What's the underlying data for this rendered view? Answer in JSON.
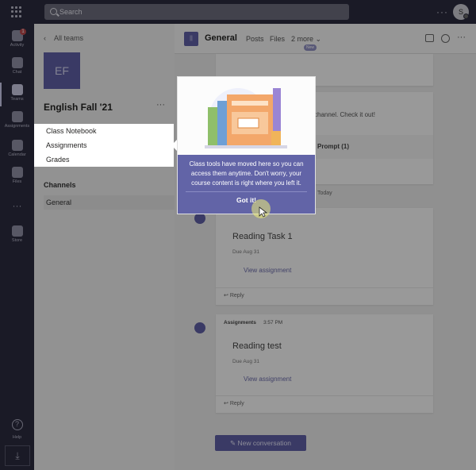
{
  "topbar": {
    "search_placeholder": "Search",
    "more_dots": "···",
    "avatar_initial": "S"
  },
  "rail": {
    "items": [
      {
        "label": "Activity",
        "icon": "bell-icon",
        "badge": "1"
      },
      {
        "label": "Chat",
        "icon": "chat-icon"
      },
      {
        "label": "Teams",
        "icon": "teams-icon"
      },
      {
        "label": "Assignments",
        "icon": "assignments-icon"
      },
      {
        "label": "Calendar",
        "icon": "calendar-icon"
      },
      {
        "label": "Files",
        "icon": "files-icon"
      },
      {
        "label": "Store",
        "icon": "store-icon"
      }
    ],
    "ellipsis": "···",
    "help_label": "Help",
    "help_glyph": "?",
    "download_glyph": "⤓"
  },
  "team": {
    "back_label": "All teams",
    "logo_initials": "EF",
    "name": "English Fall '21",
    "more": "···",
    "tools": [
      "Class Notebook",
      "Assignments",
      "Grades"
    ],
    "channels_heading": "Channels",
    "channels": [
      "General"
    ]
  },
  "channel": {
    "icon_text": "||",
    "name": "General",
    "tabs": [
      "Posts",
      "Files",
      "2 more ⌄"
    ],
    "new_pill": "New",
    "more": "···"
  },
  "feed": {
    "partial_text": "channel. Check it out!",
    "partial_prompt": "Prompt (1)",
    "today_label": "Today",
    "posts": [
      {
        "author": "",
        "time": "",
        "title": "Reading Task 1",
        "due": "Due Aug 31",
        "view": "View assignment",
        "reply": "Reply"
      },
      {
        "author": "Assignments",
        "time": "3:57 PM",
        "title": "Reading test",
        "due": "Due Aug 31",
        "view": "View assignment",
        "reply": "Reply"
      }
    ],
    "new_conversation": "New conversation"
  },
  "popover": {
    "message": "Class tools have moved here so you can access them anytime. Don't worry, your course content is right where you left it.",
    "button": "Got it!"
  },
  "colors": {
    "accent": "#6264a7",
    "rail": "#2a2a3e",
    "badge": "#b9464a"
  }
}
